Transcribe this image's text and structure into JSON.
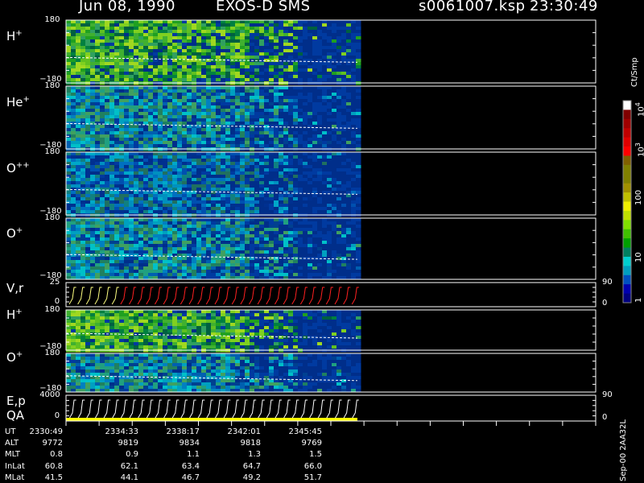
{
  "header": {
    "date": "Jun 08, 1990",
    "instrument": "EXOS-D SMS",
    "file": "s0061007.ksp",
    "time": "23:30:49"
  },
  "colorbar": {
    "unit": "Ct/Smp",
    "ticks": [
      "1",
      "10",
      "100",
      "10",
      "10"
    ],
    "tick_exponents": [
      "",
      "",
      "",
      "3",
      "4"
    ],
    "colors": [
      "#000080",
      "#0000b0",
      "#0050c0",
      "#00a0c0",
      "#00d0d0",
      "#008060",
      "#00a000",
      "#40c000",
      "#80e000",
      "#c0e000",
      "#f0f000",
      "#c0c000",
      "#a09000",
      "#808000",
      "#808000",
      "#806000",
      "#ff0000",
      "#e00000",
      "#c00000",
      "#a00000",
      "#800000",
      "#ffffff"
    ]
  },
  "side_note": "Sep-00 2AA32L",
  "panels": [
    {
      "id": "H+ top",
      "label": "H",
      "sup": "+",
      "ymax": "180",
      "ymin": "−180",
      "kind": "spec"
    },
    {
      "id": "He+",
      "label": "He",
      "sup": "+",
      "ymax": "180",
      "ymin": "−180",
      "kind": "spec"
    },
    {
      "id": "O++",
      "label": "O",
      "sup": "++",
      "ymax": "180",
      "ymin": "−180",
      "kind": "spec"
    },
    {
      "id": "O+ top",
      "label": "O",
      "sup": "+",
      "ymax": "180",
      "ymin": "−180",
      "kind": "spec"
    },
    {
      "id": "V,r",
      "label": "V,r",
      "sup": "",
      "ymax": "25",
      "ymin": "0",
      "rmax": "90",
      "rmin": "0",
      "kind": "line"
    },
    {
      "id": "H+ low",
      "label": "H",
      "sup": "+",
      "ymax": "180",
      "ymin": "−180",
      "kind": "spec"
    },
    {
      "id": "O+ low",
      "label": "O",
      "sup": "+",
      "ymax": "180",
      "ymin": "−180",
      "kind": "spec"
    },
    {
      "id": "E,p",
      "label": "E,p",
      "sup": "",
      "label2": "QA",
      "ymax": "4000",
      "ymin": "0",
      "rmax": "90",
      "rmin": "0",
      "kind": "line"
    }
  ],
  "ephemeris": {
    "labels": [
      "UT",
      "ALT",
      "MLT",
      "InLat",
      "MLat"
    ],
    "columns": [
      [
        "2330:49",
        "9772",
        "0.8",
        "60.8",
        "41.5"
      ],
      [
        "2334:33",
        "9819",
        "0.9",
        "62.1",
        "44.1"
      ],
      [
        "2338:17",
        "9834",
        "1.1",
        "63.4",
        "46.7"
      ],
      [
        "2342:01",
        "9818",
        "1.3",
        "64.7",
        "49.2"
      ],
      [
        "2345:45",
        "9769",
        "1.5",
        "66.0",
        "51.7"
      ]
    ]
  },
  "chart_data": {
    "type": "heatmap",
    "title": "Jun 08, 1990   EXOS-D SMS",
    "x_tick_labels": [
      "2330:49",
      "2334:33",
      "2338:17",
      "2342:01",
      "2345:45"
    ],
    "data_fraction_of_time_axis": 0.55,
    "series": [
      {
        "name": "H+",
        "ylim": [
          -180,
          180
        ],
        "intensity_level": "high"
      },
      {
        "name": "He+",
        "ylim": [
          -180,
          180
        ],
        "intensity_level": "medium"
      },
      {
        "name": "O++",
        "ylim": [
          -180,
          180
        ],
        "intensity_level": "low-medium"
      },
      {
        "name": "O+",
        "ylim": [
          -180,
          180
        ],
        "intensity_level": "medium"
      },
      {
        "name": "V,r",
        "ylim": [
          0,
          25
        ],
        "y2lim": [
          0,
          90
        ]
      },
      {
        "name": "H+",
        "ylim": [
          -180,
          180
        ],
        "intensity_level": "high"
      },
      {
        "name": "O+",
        "ylim": [
          -180,
          180
        ],
        "intensity_level": "medium"
      },
      {
        "name": "E,p",
        "ylim": [
          0,
          4000
        ],
        "y2lim": [
          0,
          90
        ]
      }
    ],
    "colorbar_label": "Ct/Smp",
    "colorbar_scale": "log"
  }
}
